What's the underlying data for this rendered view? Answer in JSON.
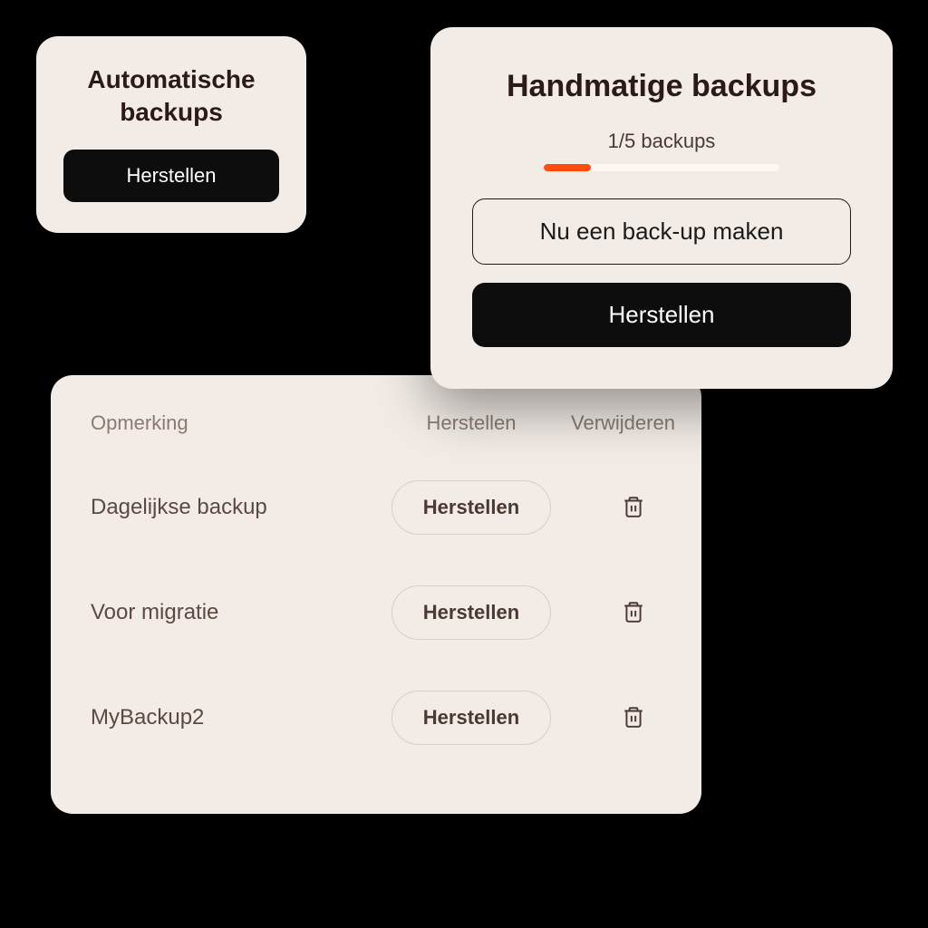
{
  "auto": {
    "title": "Automatische backups",
    "restore_label": "Herstellen"
  },
  "manual": {
    "title": "Handmatige backups",
    "quota_text": "1/5 backups",
    "progress_percent": 20,
    "backup_now_label": "Nu een back-up maken",
    "restore_label": "Herstellen"
  },
  "table": {
    "header": {
      "note": "Opmerking",
      "restore": "Herstellen",
      "delete": "Verwijderen"
    },
    "rows": [
      {
        "note": "Dagelijkse backup",
        "restore": "Herstellen"
      },
      {
        "note": "Voor migratie",
        "restore": "Herstellen"
      },
      {
        "note": "MyBackup2",
        "restore": "Herstellen"
      }
    ]
  },
  "colors": {
    "card_bg": "#f2ebe6",
    "accent": "#ff4d0d",
    "dark": "#0d0d0d"
  }
}
